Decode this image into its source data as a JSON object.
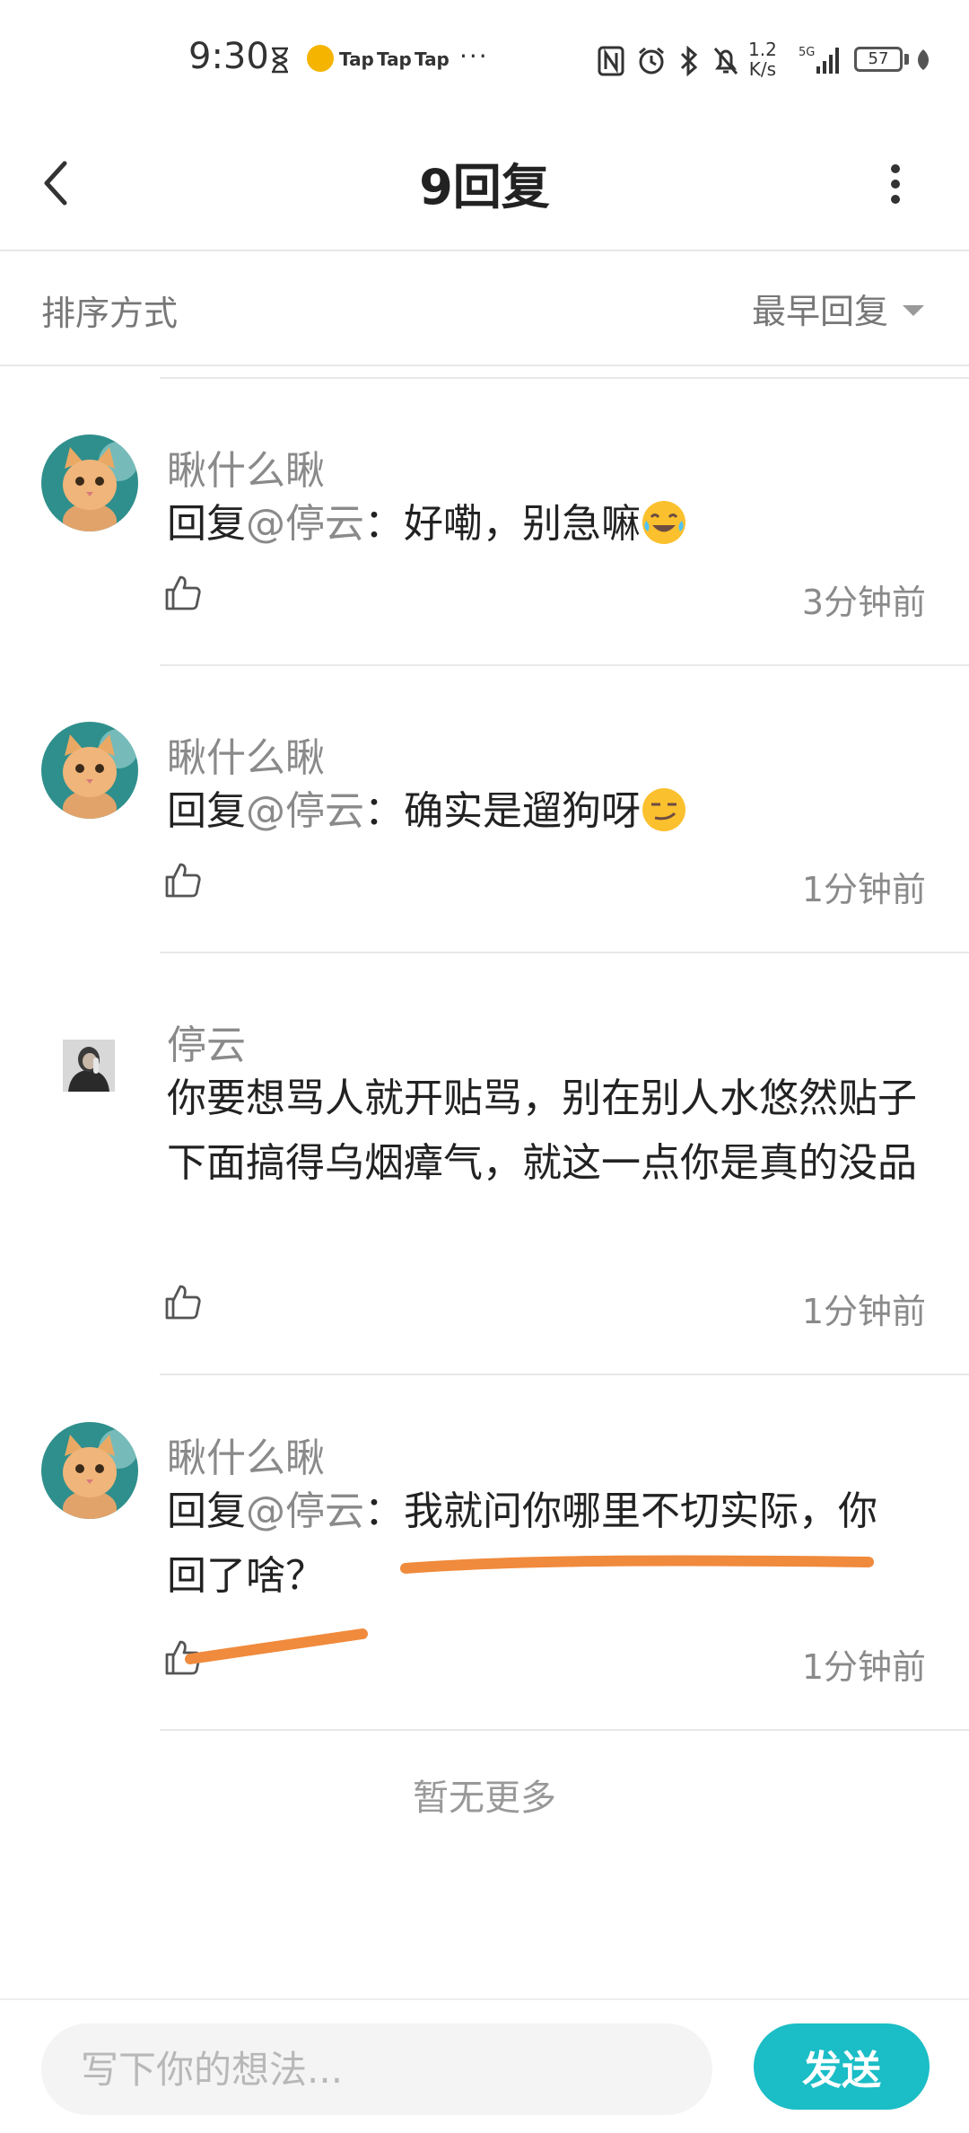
{
  "status_bar": {
    "time": "9:30",
    "tap_labels": [
      "Tap",
      "Tap",
      "Tap"
    ],
    "more_dots": "···",
    "net_speed_value": "1.2",
    "net_speed_unit": "K/s",
    "network": "5G",
    "battery": "57"
  },
  "header": {
    "title": "9回复",
    "back_icon": "chevron-left-icon",
    "more_icon": "more-vertical-icon"
  },
  "sort": {
    "label": "排序方式",
    "value": "最早回复"
  },
  "comments": [
    {
      "author": "瞅什么瞅",
      "reply_prefix": "回复",
      "mention": "@停云",
      "separator": "：",
      "text": "好嘞，别急嘛",
      "emoji": "laugh-cry-emoji",
      "time": "3分钟前"
    },
    {
      "author": "瞅什么瞅",
      "reply_prefix": "回复",
      "mention": "@停云",
      "separator": "：",
      "text": "确实是遛狗呀",
      "emoji": "smirk-emoji",
      "time": "1分钟前"
    },
    {
      "author": "停云",
      "text": "你要想骂人就开贴骂，别在别人水悠然贴子下面搞得乌烟瘴气，就这一点你是真的没品",
      "time": "1分钟前"
    },
    {
      "author": "瞅什么瞅",
      "reply_prefix": "回复",
      "mention": "@停云",
      "separator": "：",
      "text": "我就问你哪里不切实际，你回了啥？",
      "time": "1分钟前"
    }
  ],
  "no_more": "暂无更多",
  "bottom_bar": {
    "input_placeholder": "写下你的想法...",
    "send_label": "发送"
  },
  "colors": {
    "accent": "#1bbdc6",
    "annotation": "#f08a3c",
    "muted_text": "#8a8a8a"
  }
}
